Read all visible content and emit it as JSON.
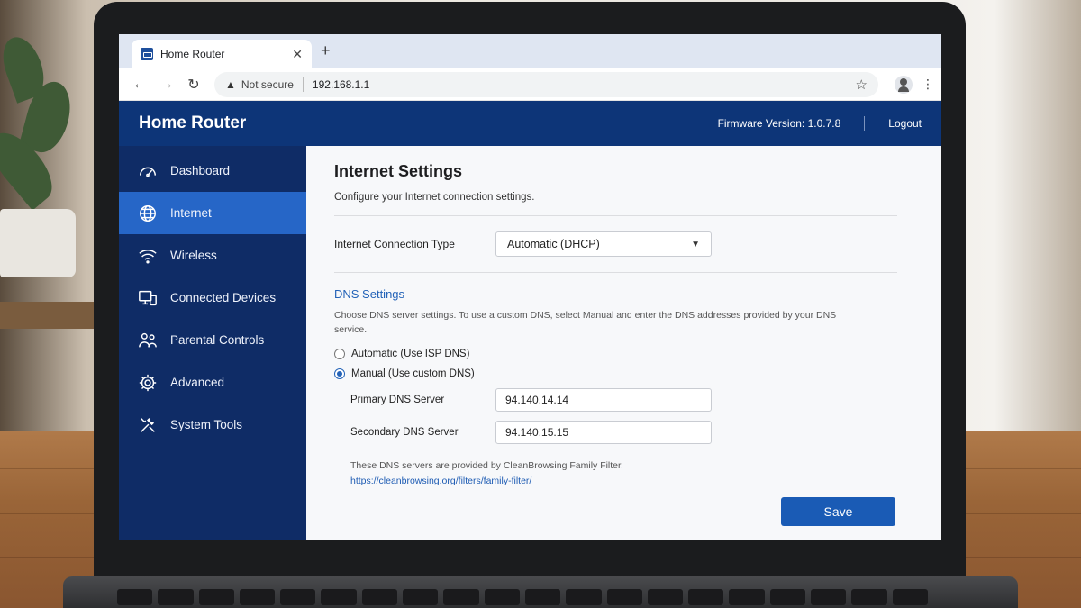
{
  "browser": {
    "tab_title": "Home Router",
    "new_tab": "+",
    "close": "✕",
    "security_label": "Not secure",
    "url": "192.168.1.1"
  },
  "header": {
    "title": "Home Router",
    "firmware": "Firmware Version: 1.0.7.8",
    "logout": "Logout"
  },
  "sidebar": {
    "items": [
      {
        "label": "Dashboard",
        "icon": "gauge-icon"
      },
      {
        "label": "Internet",
        "icon": "globe-icon",
        "active": true
      },
      {
        "label": "Wireless",
        "icon": "wifi-icon"
      },
      {
        "label": "Connected Devices",
        "icon": "devices-icon"
      },
      {
        "label": "Parental Controls",
        "icon": "family-icon"
      },
      {
        "label": "Advanced",
        "icon": "gear-icon"
      },
      {
        "label": "System Tools",
        "icon": "tools-icon"
      }
    ]
  },
  "main": {
    "title": "Internet Settings",
    "subtitle": "Configure your Internet connection settings.",
    "connection_type_label": "Internet Connection Type",
    "connection_type_value": "Automatic (DHCP)",
    "dns": {
      "title": "DNS Settings",
      "description": "Choose DNS server settings. To use a custom DNS, select Manual and enter the DNS addresses provided by your DNS service.",
      "option_auto": "Automatic (Use ISP DNS)",
      "option_manual": "Manual (Use custom DNS)",
      "selected": "manual",
      "primary_label": "Primary DNS Server",
      "primary_value": "94.140.14.14",
      "secondary_label": "Secondary DNS Server",
      "secondary_value": "94.140.15.15",
      "note": "These DNS servers are provided by CleanBrowsing Family Filter.",
      "link": "https://cleanbrowsing.org/filters/family-filter/"
    },
    "save_label": "Save"
  },
  "colors": {
    "header_bg": "#0d3578",
    "sidebar_bg": "#0f2c66",
    "active_item": "#2666c7",
    "accent": "#2463b8",
    "save_button": "#1a5bb5"
  }
}
